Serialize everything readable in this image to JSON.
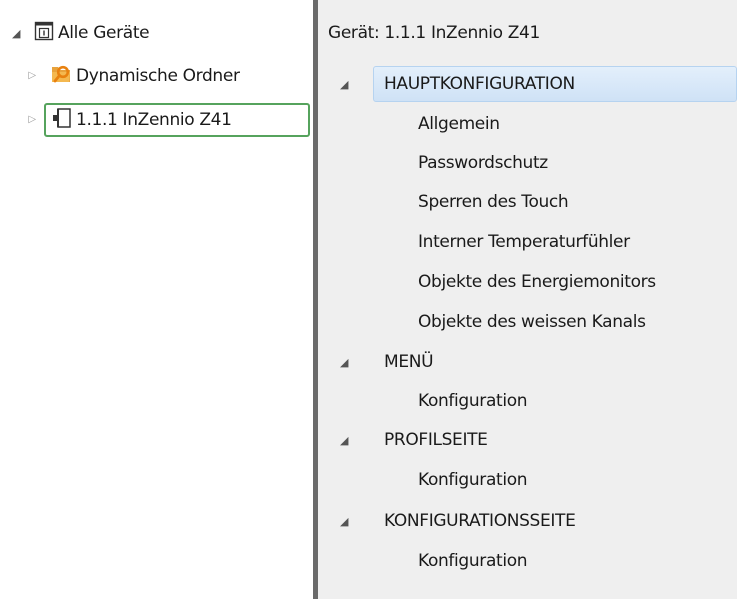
{
  "left_tree": {
    "root": {
      "label": "Alle Geräte"
    },
    "items": [
      {
        "label": "Dynamische Ordner"
      },
      {
        "label": "1.1.1  InZennio Z41"
      }
    ]
  },
  "right_tree": {
    "header": "Gerät: 1.1.1  InZennio Z41",
    "sections": [
      {
        "label": "HAUPTKONFIGURATION",
        "children": [
          "Allgemein",
          "Passwordschutz",
          "Sperren des Touch",
          "Interner Temperaturfühler",
          "Objekte des Energiemonitors",
          "Objekte des weissen Kanals"
        ]
      },
      {
        "label": "MENÜ",
        "children": [
          "Konfiguration"
        ]
      },
      {
        "label": "PROFILSEITE",
        "children": [
          "Konfiguration"
        ]
      },
      {
        "label": "KONFIGURATIONSSEITE",
        "children": [
          "Konfiguration"
        ]
      }
    ]
  },
  "colors": {
    "selection_border": "#56a35d",
    "section_highlight": "#cfe2f6",
    "splitter": "#6a6a6a",
    "right_background": "#efefef"
  },
  "icons": {
    "root": "device-list-icon",
    "dynamic_folder": "dynamic-folder-icon",
    "device": "device-icon",
    "expanded": "expanded-triangle-icon",
    "collapsed": "collapsed-triangle-icon"
  }
}
